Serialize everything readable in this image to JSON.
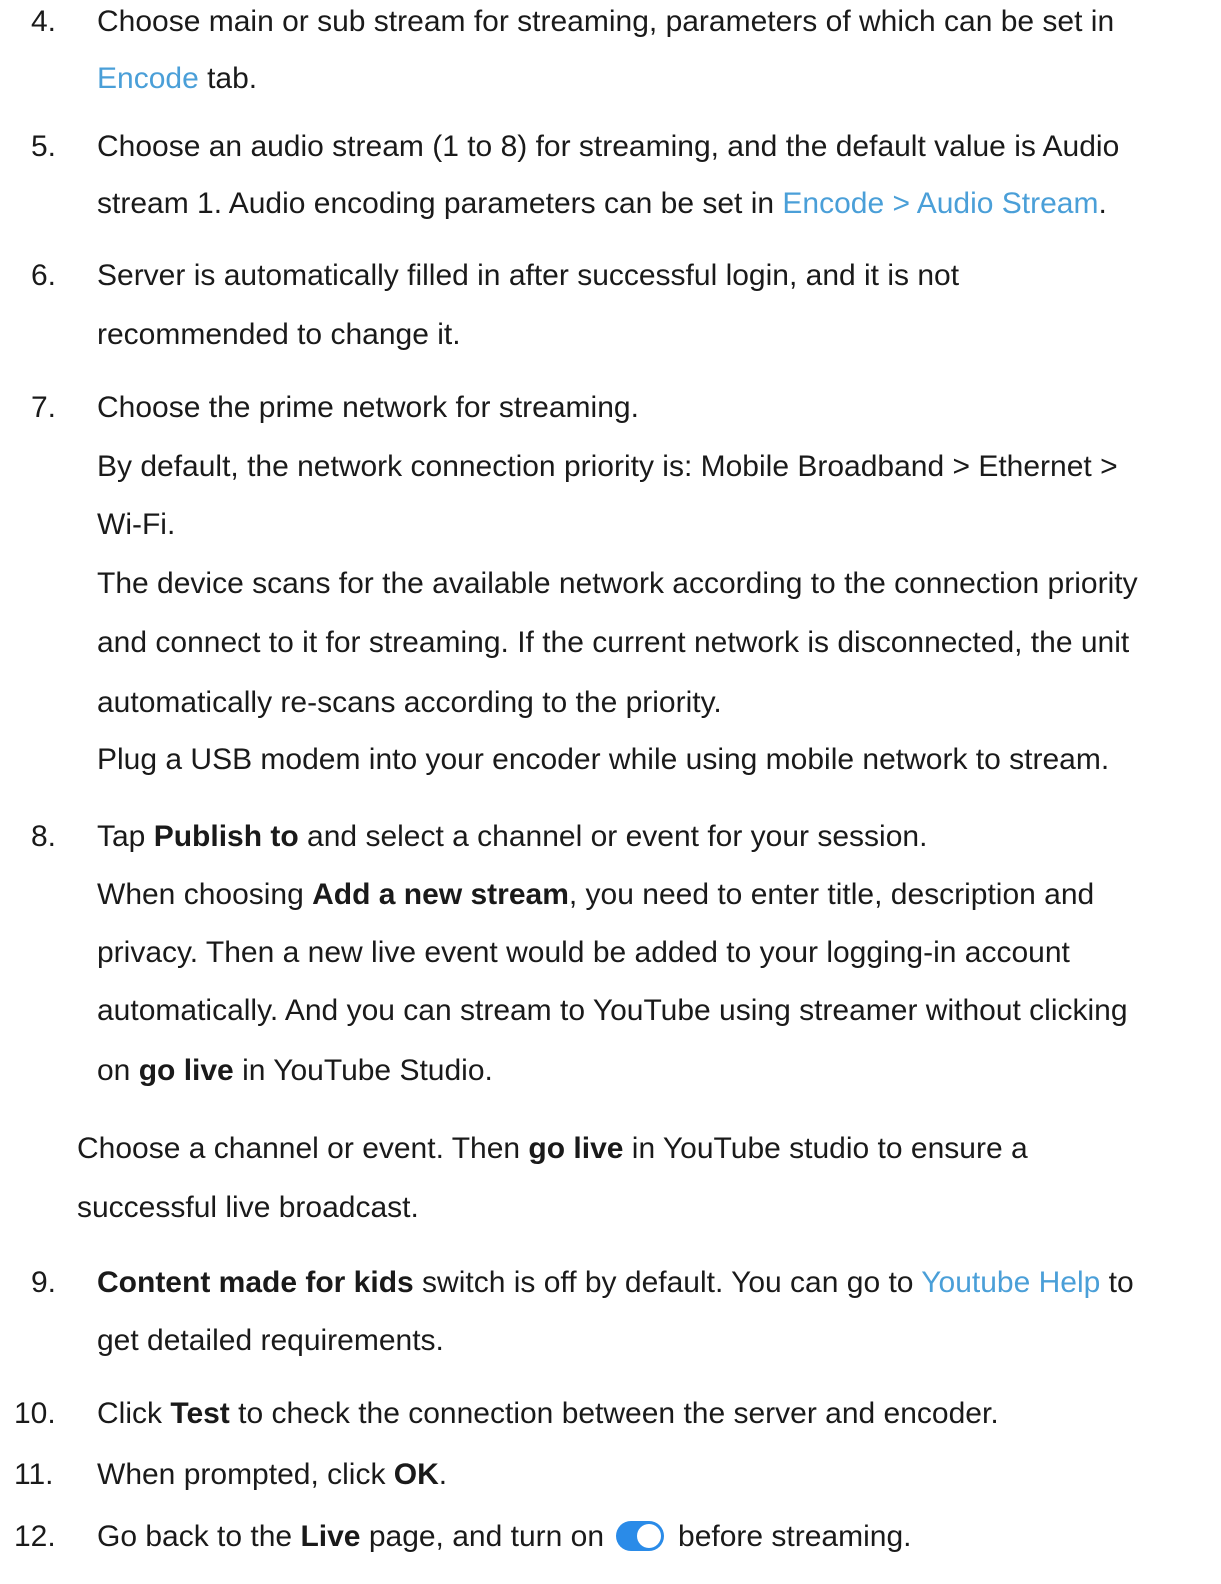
{
  "items": {
    "s4": {
      "num": "4.",
      "l1": "Choose main or sub stream for streaming, parameters of which can be set in",
      "l2_link": "Encode",
      "l2_rest": " tab."
    },
    "s5": {
      "num": "5.",
      "l1": "Choose an audio stream (1 to 8) for streaming, and the default value is Audio",
      "l2_pre": "stream 1. Audio encoding parameters can be set in ",
      "l2_link": "Encode > Audio Stream",
      "l2_post": "."
    },
    "s6": {
      "num": "6.",
      "l1": "Server is automatically filled in after successful login, and it is not",
      "l2": "recommended to change it."
    },
    "s7": {
      "num": "7.",
      "l1": "Choose the prime network for streaming.",
      "l2": "By default, the network connection priority is: Mobile Broadband > Ethernet >",
      "l3": "Wi-Fi.",
      "l4": "The device scans for the available network according to the connection priority",
      "l5": "and connect to it for streaming. If the current network is disconnected, the unit",
      "l6": "automatically re-scans according to the priority.",
      "l7": "Plug a USB modem into your encoder while using mobile network to stream."
    },
    "s8": {
      "num": "8.",
      "l1_pre": "Tap ",
      "l1_bold": "Publish to",
      "l1_post": " and select a channel or event for your session.",
      "l2_pre": "When choosing ",
      "l2_bold": "Add a new stream",
      "l2_post": ", you need to enter title, description and",
      "l3": "privacy. Then a new live event would be added to your logging-in account",
      "l4": "automatically. And you can stream to YouTube using streamer without clicking",
      "l5_pre": "on ",
      "l5_bold": "go live",
      "l5_post": " in YouTube Studio."
    },
    "note": {
      "l1_pre": "Choose a channel or event. Then ",
      "l1_bold": "go live",
      "l1_post": " in YouTube studio to ensure a",
      "l2": "successful live broadcast."
    },
    "s9": {
      "num": "9.",
      "l1_bold": "Content made for kids",
      "l1_mid": " switch is off by default. You can go to ",
      "l1_link": "Youtube Help",
      "l1_post": " to",
      "l2": "get detailed requirements."
    },
    "s10": {
      "num": "10.",
      "l1_pre": "Click ",
      "l1_bold": "Test",
      "l1_post": " to check the connection between the server and encoder."
    },
    "s11": {
      "num": "11.",
      "l1_pre": "When prompted, click ",
      "l1_bold": "OK",
      "l1_post": "."
    },
    "s12": {
      "num": "12.",
      "l1_pre": "Go back to the ",
      "l1_bold": "Live",
      "l1_mid": " page, and turn on",
      "l1_post": "before streaming."
    }
  },
  "colors": {
    "link": "#4a9fd8",
    "toggle_on": "#2a8be8"
  },
  "icons": {
    "live_toggle": "toggle-switch-on-icon"
  }
}
